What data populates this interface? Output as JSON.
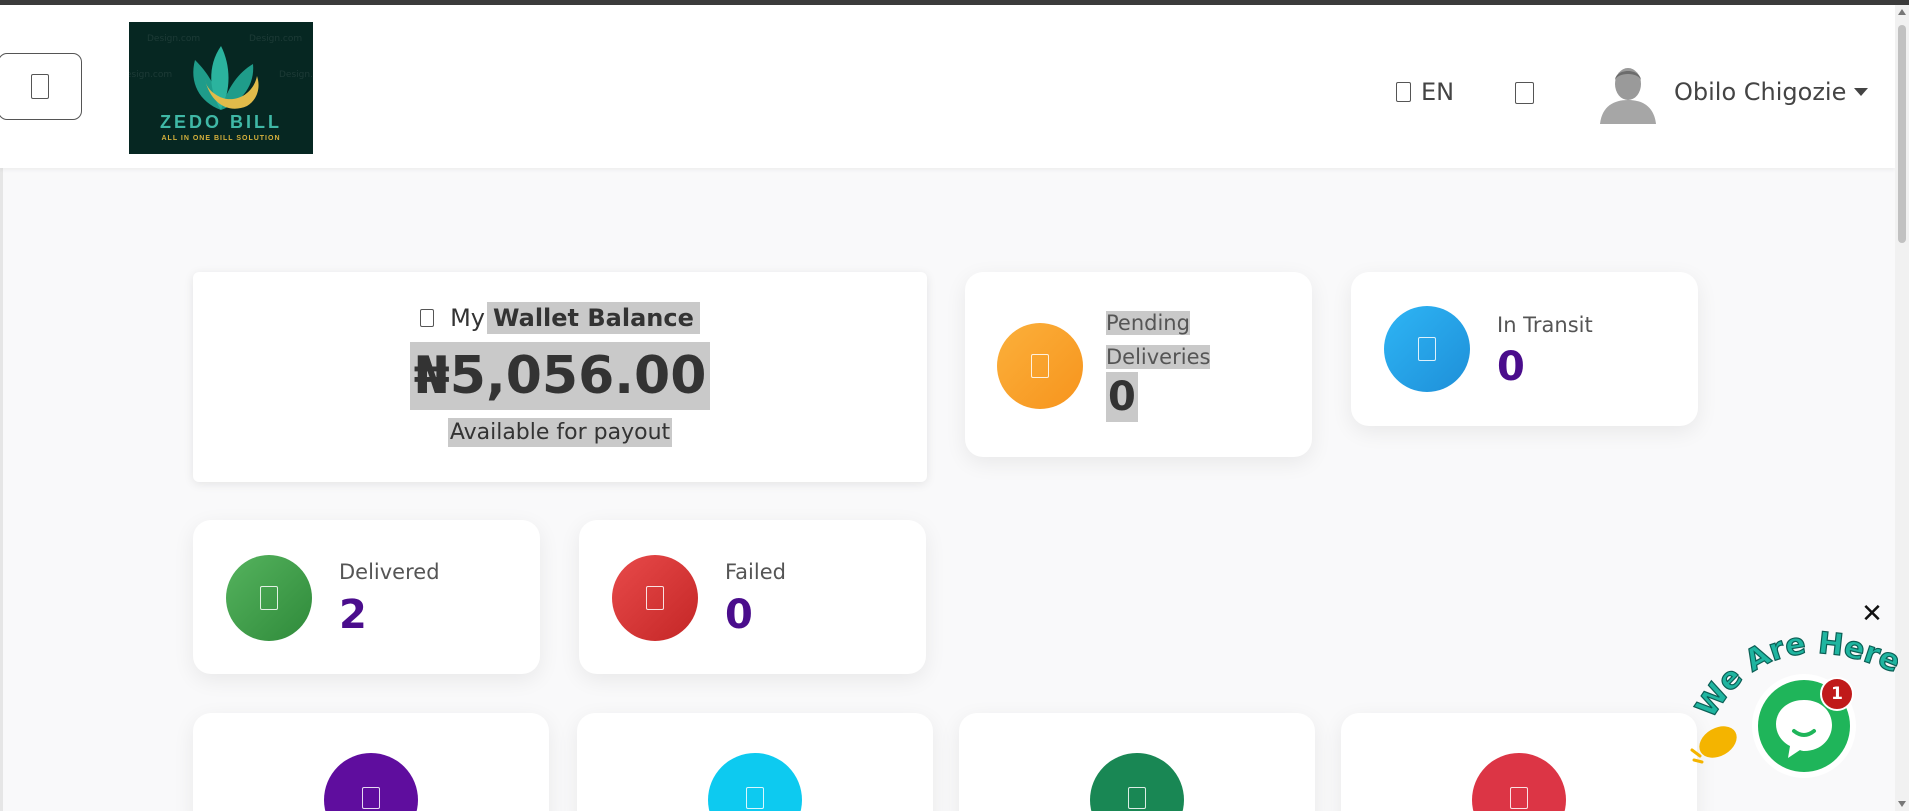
{
  "header": {
    "menu_icon": "glyph-box-icon",
    "logo": {
      "title": "ZEDO BILL",
      "tagline": "ALL IN ONE BILL SOLUTION",
      "watermark": "Design.com"
    },
    "language": "EN",
    "language_icon": "globe-icon",
    "notification_icon": "bell-icon",
    "user_name": "Obilo Chigozie"
  },
  "wallet": {
    "prefix": "My",
    "title": "Wallet Balance",
    "amount": "₦5,056.00",
    "subtitle": "Available for payout"
  },
  "stats": {
    "pending": {
      "label": "Pending Deliveries",
      "label_line1": "Pending",
      "label_line2": "Deliveries",
      "value": "0",
      "color": "#f7941d"
    },
    "in_transit": {
      "label": "In Transit",
      "value": "0",
      "color": "#1e9be6"
    },
    "delivered": {
      "label": "Delivered",
      "value": "2",
      "color": "#3d9b47"
    },
    "failed": {
      "label": "Failed",
      "value": "0",
      "color": "#d63131"
    }
  },
  "bottom_cards": [
    {
      "color": "#5f0d9e"
    },
    {
      "color": "#0dcaf0"
    },
    {
      "color": "#198754"
    },
    {
      "color": "#dc3545"
    }
  ],
  "chat": {
    "banner": "We Are Here!",
    "badge": "1",
    "close": "✕"
  },
  "colors": {
    "accent_value": "#4a0d8c",
    "chat_green": "#1fb55a"
  }
}
